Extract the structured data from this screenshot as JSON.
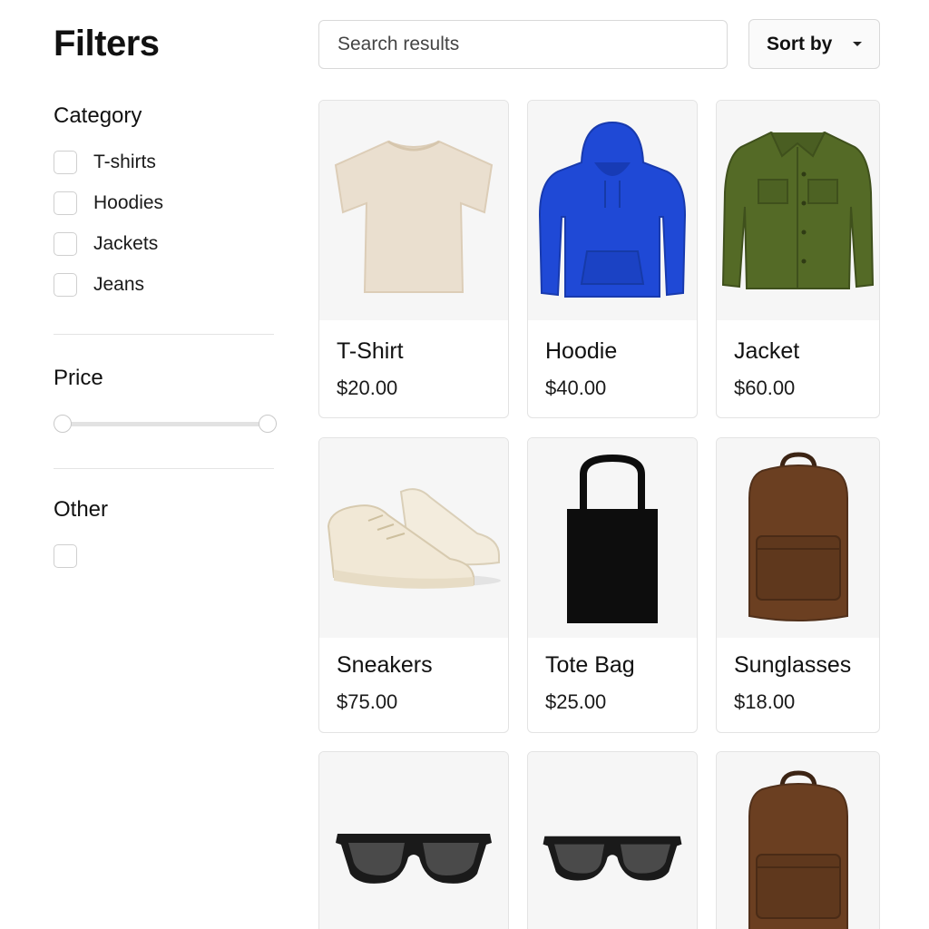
{
  "sidebar": {
    "title": "Filters",
    "category": {
      "title": "Category",
      "options": [
        {
          "label": "T-shirts",
          "checked": false
        },
        {
          "label": "Hoodies",
          "checked": false
        },
        {
          "label": "Jackets",
          "checked": false
        },
        {
          "label": "Jeans",
          "checked": false
        }
      ]
    },
    "price": {
      "title": "Price",
      "range_min_fraction": 0,
      "range_max_fraction": 1
    },
    "other": {
      "title": "Other",
      "option": {
        "label": "",
        "checked": false
      }
    }
  },
  "toolbar": {
    "search_placeholder": "Search results",
    "sort_label": "Sort by"
  },
  "products": [
    {
      "name": "T-Shirt",
      "price": "$20.00",
      "image": "tshirt-image",
      "color": "#eadfcf"
    },
    {
      "name": "Hoodie",
      "price": "$40.00",
      "image": "hoodie-image",
      "color": "#1f49d6"
    },
    {
      "name": "Jacket",
      "price": "$60.00",
      "image": "jacket-image",
      "color": "#546a26"
    },
    {
      "name": "Sneakers",
      "price": "$75.00",
      "image": "sneakers-image",
      "color": "#f1e8d6"
    },
    {
      "name": "Tote Bag",
      "price": "$25.00",
      "image": "tote-bag-image",
      "color": "#0d0d0d"
    },
    {
      "name": "Sunglasses",
      "price": "$18.00",
      "image": "backpack-image",
      "color": "#6b3f21"
    },
    {
      "name": "",
      "price": "",
      "image": "sunglasses-image",
      "color": "#1a1a1a"
    },
    {
      "name": "",
      "price": "",
      "image": "sunglasses-image",
      "color": "#1a1a1a"
    },
    {
      "name": "",
      "price": "",
      "image": "backpack-image",
      "color": "#6b3f21"
    }
  ]
}
